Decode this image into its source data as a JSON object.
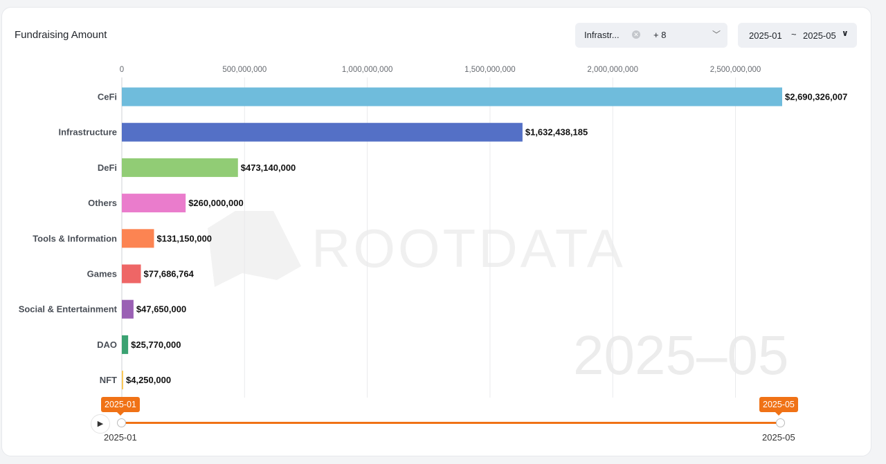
{
  "title": "Fundraising Amount",
  "filter": {
    "selected_tag": "Infrastr...",
    "more_count": "+ 8"
  },
  "date_range": {
    "start": "2025-01",
    "separator": "~",
    "end": "2025-05"
  },
  "watermark": {
    "logo_text": "ROOTDATA",
    "current_period": "2025–05"
  },
  "slider": {
    "start_badge": "2025-01",
    "end_badge": "2025-05",
    "start_label": "2025-01",
    "end_label": "2025-05"
  },
  "chart_data": {
    "type": "bar",
    "orientation": "horizontal",
    "title": "Fundraising Amount",
    "xlim": [
      0,
      2700000000
    ],
    "x_ticks": [
      0,
      500000000,
      1000000000,
      1500000000,
      2000000000,
      2500000000
    ],
    "x_tick_labels": [
      "0",
      "500,000,000",
      "1,000,000,000",
      "1,500,000,000",
      "2,000,000,000",
      "2,500,000,000"
    ],
    "grid": true,
    "categories": [
      "CeFi",
      "Infrastructure",
      "DeFi",
      "Others",
      "Tools & Information",
      "Games",
      "Social & Entertainment",
      "DAO",
      "NFT"
    ],
    "values": [
      2690326007,
      1632438185,
      473140000,
      260000000,
      131150000,
      77686764,
      47650000,
      25770000,
      4250000
    ],
    "value_labels": [
      "$2,690,326,007",
      "$1,632,438,185",
      "$473,140,000",
      "$260,000,000",
      "$131,150,000",
      "$77,686,764",
      "$47,650,000",
      "$25,770,000",
      "$4,250,000"
    ],
    "colors": [
      "#6fbcdc",
      "#5470c6",
      "#91cc75",
      "#ea7ccc",
      "#fc8452",
      "#ee6666",
      "#9a60b4",
      "#3ba272",
      "#fac858"
    ]
  }
}
